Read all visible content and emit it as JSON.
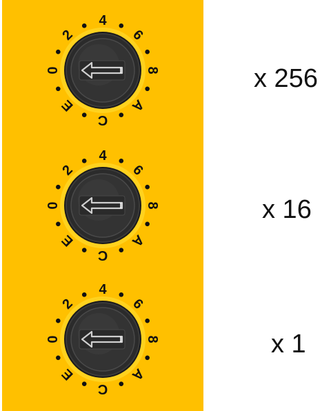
{
  "panel": {
    "color": "#ffc000"
  },
  "switches": [
    {
      "multiplier": "x 256",
      "scale": [
        "0",
        "2",
        "4",
        "6",
        "8",
        "A",
        "C",
        "E"
      ]
    },
    {
      "multiplier": "x 16",
      "scale": [
        "0",
        "2",
        "4",
        "6",
        "8",
        "A",
        "C",
        "E"
      ]
    },
    {
      "multiplier": "x 1",
      "scale": [
        "0",
        "2",
        "4",
        "6",
        "8",
        "A",
        "C",
        "E"
      ]
    }
  ],
  "icons": {
    "knob": "rotary-knob",
    "pointer": "arrow-pointer-icon"
  }
}
